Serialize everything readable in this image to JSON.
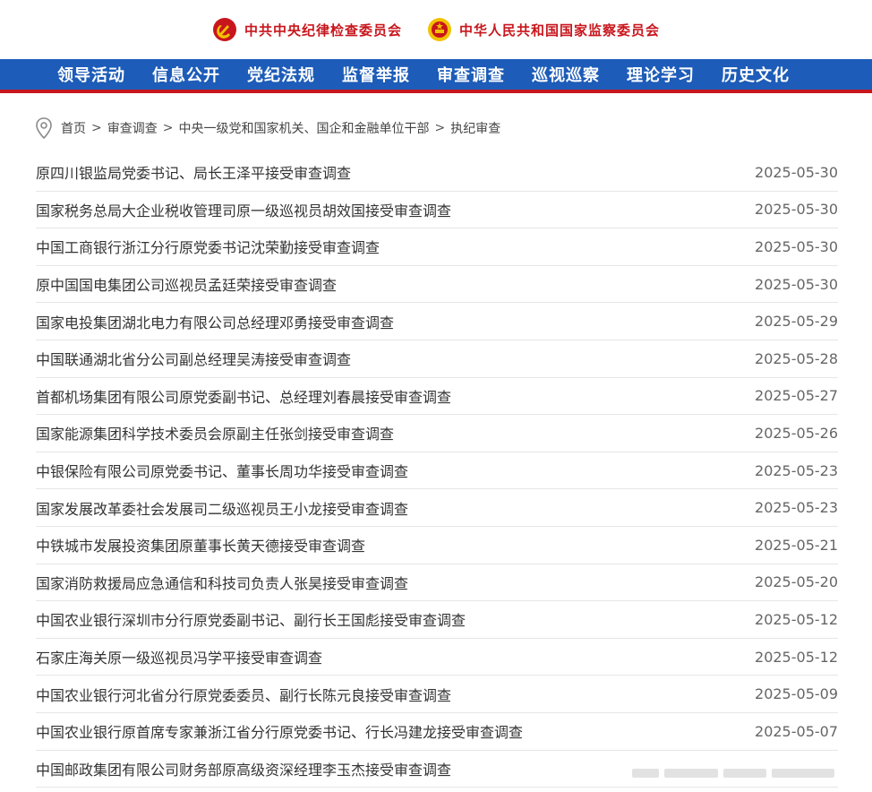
{
  "header": {
    "org1": "中共中央纪律检查委员会",
    "org2": "中华人民共和国国家监察委员会",
    "colors": {
      "brand_red": "#c8161d",
      "nav_blue": "#1d5cb8",
      "emblem_gold": "#f2c200"
    },
    "icons": [
      "party-emblem-icon",
      "national-emblem-icon"
    ]
  },
  "nav": {
    "items": [
      {
        "label": "领导活动"
      },
      {
        "label": "信息公开"
      },
      {
        "label": "党纪法规"
      },
      {
        "label": "监督举报"
      },
      {
        "label": "审查调查"
      },
      {
        "label": "巡视巡察"
      },
      {
        "label": "理论学习"
      },
      {
        "label": "历史文化"
      }
    ]
  },
  "breadcrumb": {
    "icon": "location-pin-icon",
    "separator": ">",
    "items": [
      {
        "label": "首页"
      },
      {
        "label": "审查调查"
      },
      {
        "label": "中央一级党和国家机关、国企和金融单位干部"
      },
      {
        "label": "执纪审查"
      }
    ]
  },
  "articles": [
    {
      "title": "原四川银监局党委书记、局长王泽平接受审查调查",
      "date": "2025-05-30"
    },
    {
      "title": "国家税务总局大企业税收管理司原一级巡视员胡效国接受审查调查",
      "date": "2025-05-30"
    },
    {
      "title": "中国工商银行浙江分行原党委书记沈荣勤接受审查调查",
      "date": "2025-05-30"
    },
    {
      "title": "原中国国电集团公司巡视员孟廷荣接受审查调查",
      "date": "2025-05-30"
    },
    {
      "title": "国家电投集团湖北电力有限公司总经理邓勇接受审查调查",
      "date": "2025-05-29"
    },
    {
      "title": "中国联通湖北省分公司副总经理吴涛接受审查调查",
      "date": "2025-05-28"
    },
    {
      "title": "首都机场集团有限公司原党委副书记、总经理刘春晨接受审查调查",
      "date": "2025-05-27"
    },
    {
      "title": "国家能源集团科学技术委员会原副主任张剑接受审查调查",
      "date": "2025-05-26"
    },
    {
      "title": "中银保险有限公司原党委书记、董事长周功华接受审查调查",
      "date": "2025-05-23"
    },
    {
      "title": "国家发展改革委社会发展司二级巡视员王小龙接受审查调查",
      "date": "2025-05-23"
    },
    {
      "title": "中铁城市发展投资集团原董事长黄天德接受审查调查",
      "date": "2025-05-21"
    },
    {
      "title": "国家消防救援局应急通信和科技司负责人张昊接受审查调查",
      "date": "2025-05-20"
    },
    {
      "title": "中国农业银行深圳市分行原党委副书记、副行长王国彪接受审查调查",
      "date": "2025-05-12"
    },
    {
      "title": "石家庄海关原一级巡视员冯学平接受审查调查",
      "date": "2025-05-12"
    },
    {
      "title": "中国农业银行河北省分行原党委委员、副行长陈元良接受审查调查",
      "date": "2025-05-09"
    },
    {
      "title": "中国农业银行原首席专家兼浙江省分行原党委书记、行长冯建龙接受审查调查",
      "date": "2025-05-07"
    },
    {
      "title": "中国邮政集团有限公司财务部原高级资深经理李玉杰接受审查调查",
      "date": ""
    }
  ]
}
